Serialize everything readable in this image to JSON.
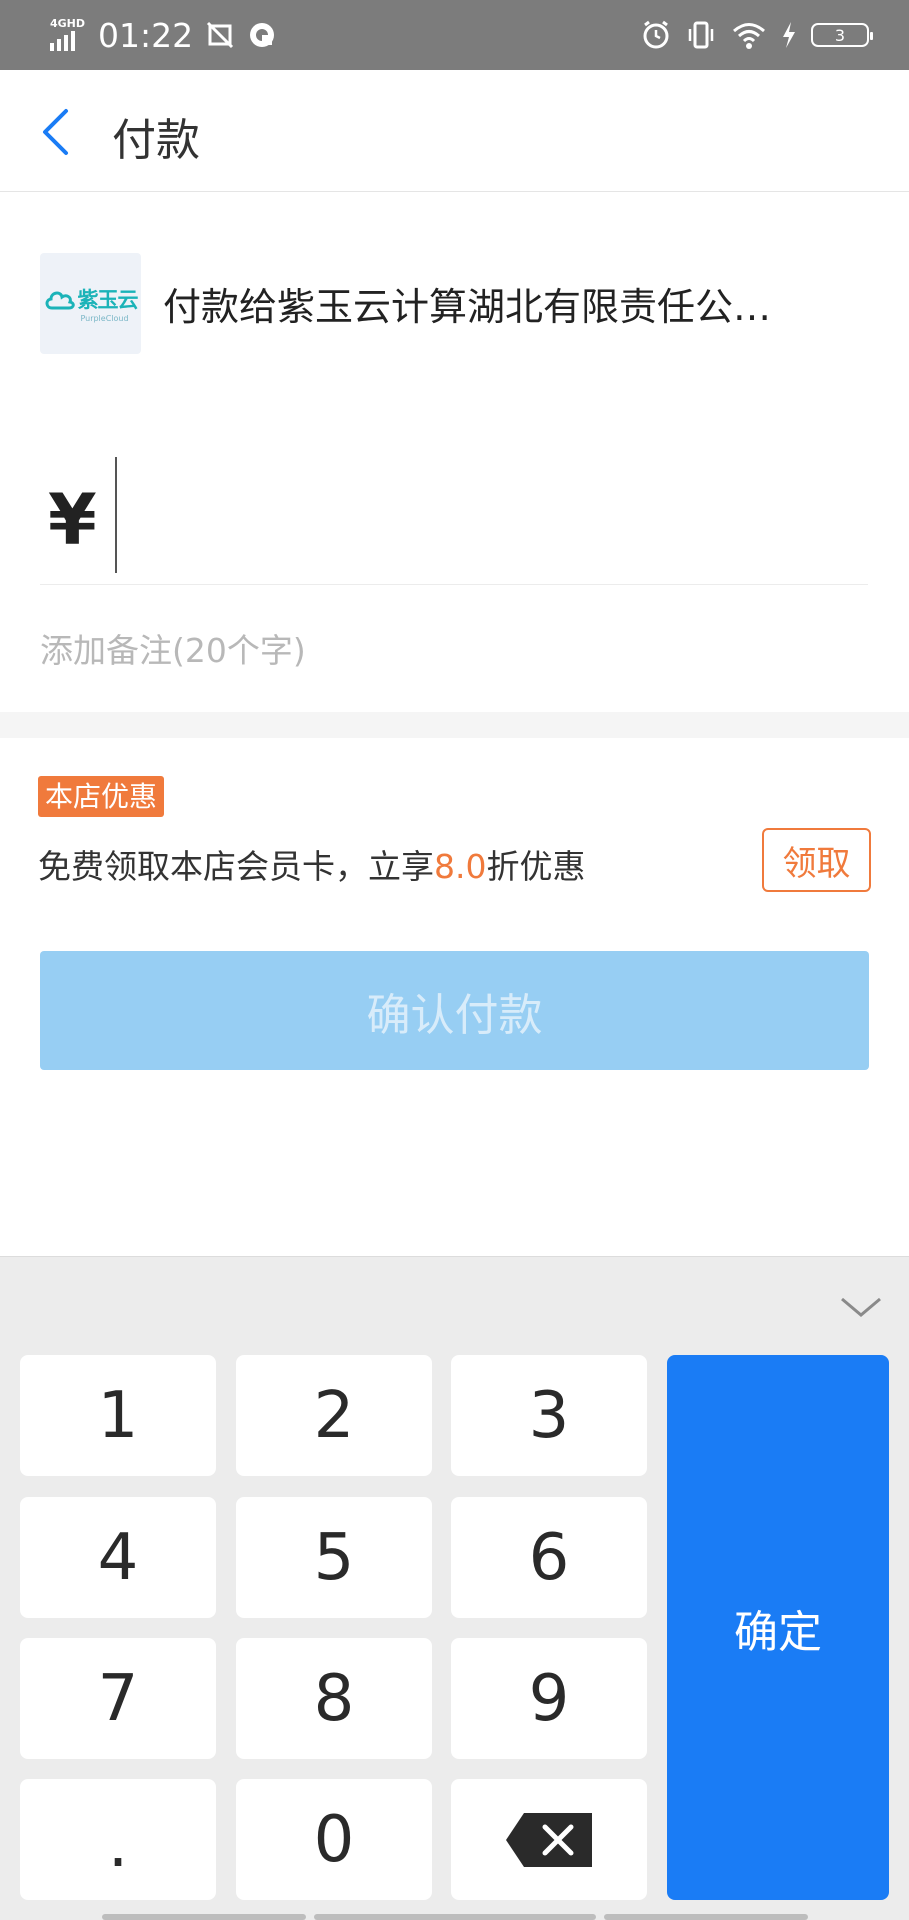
{
  "status_bar": {
    "network": "4GHD",
    "time": "01:22",
    "battery": "3"
  },
  "header": {
    "title": "付款",
    "back_icon": "chevron-left-icon"
  },
  "merchant": {
    "logo_text": "紫玉云",
    "logo_subtext": "PurpleCloud",
    "name": "付款给紫玉云计算湖北有限责任公…"
  },
  "amount": {
    "currency_symbol": "¥",
    "value": ""
  },
  "note": {
    "placeholder": "添加备注(20个字)",
    "value": ""
  },
  "promo": {
    "badge": "本店优惠",
    "text_before": "免费领取本店会员卡，立享",
    "discount": "8.0",
    "text_after": "折优惠",
    "claim_label": "领取"
  },
  "confirm_pay_label": "确认付款",
  "keypad": {
    "keys": [
      "1",
      "2",
      "3",
      "4",
      "5",
      "6",
      "7",
      "8",
      "9",
      ".",
      "0"
    ],
    "confirm_label": "确定",
    "delete_icon": "backspace-icon",
    "collapse_icon": "chevron-down-icon"
  },
  "colors": {
    "accent_blue": "#1a7cf5",
    "disabled_blue": "#97cef3",
    "promo_orange": "#f07a3c"
  }
}
